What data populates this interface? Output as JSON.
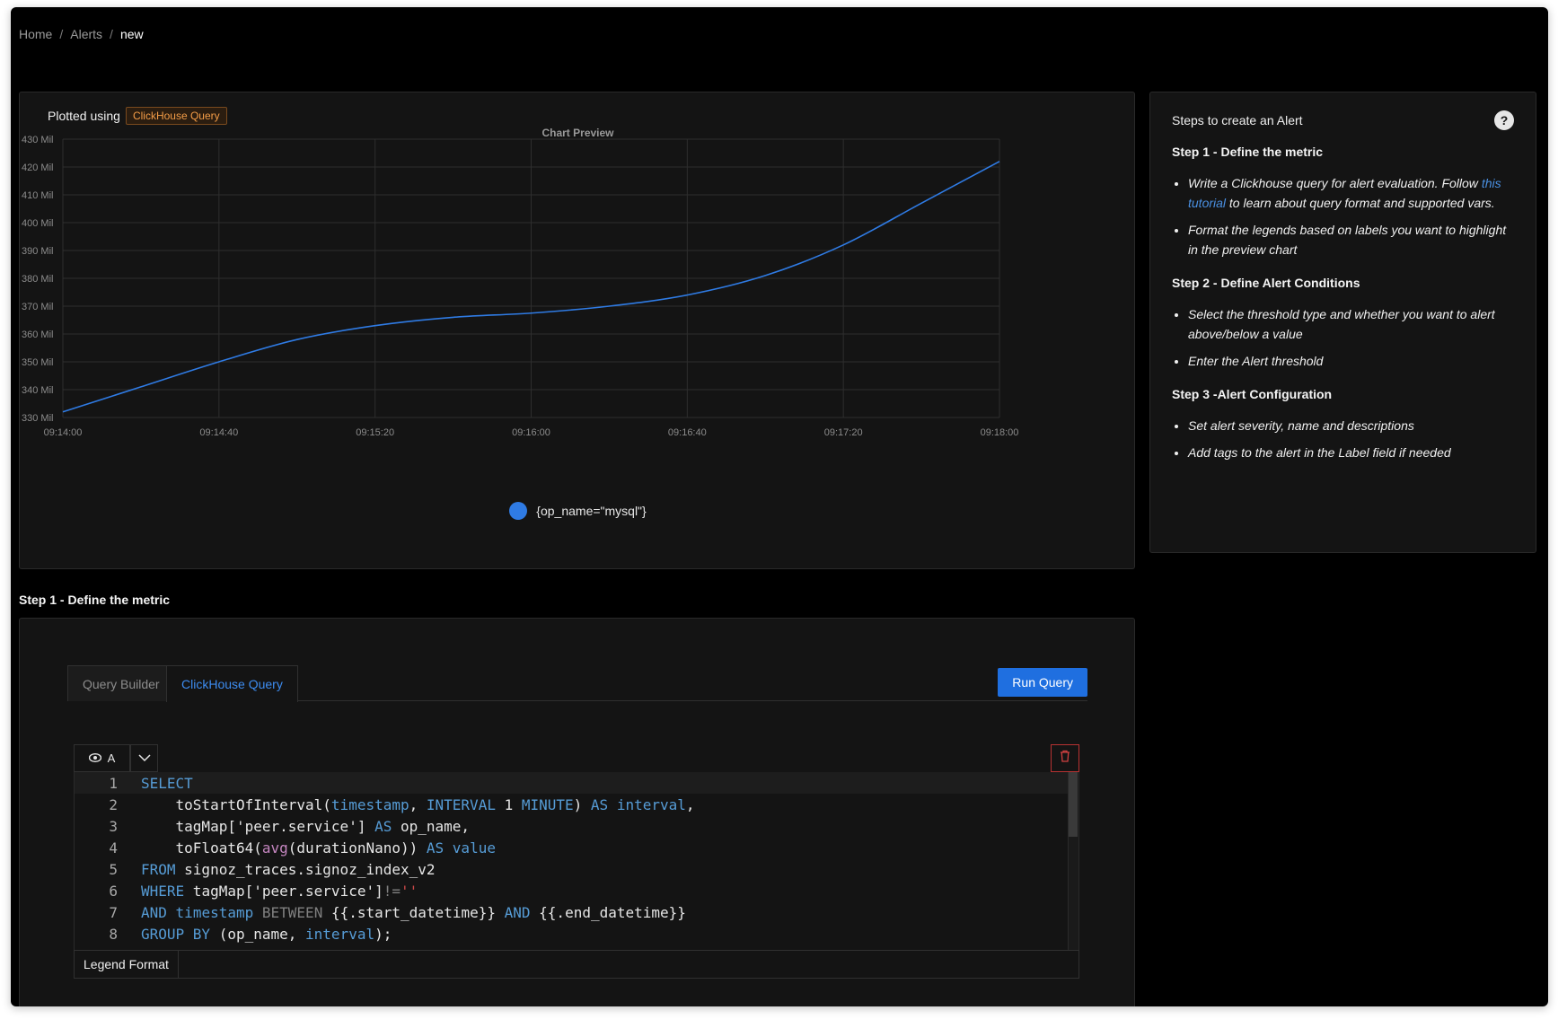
{
  "breadcrumb": {
    "items": [
      "Home",
      "Alerts",
      "new"
    ],
    "separator": "/"
  },
  "chart_panel": {
    "plotted_using_label": "Plotted using",
    "query_type_tag": "ClickHouse Query",
    "title": "Chart Preview"
  },
  "chart_data": {
    "type": "line",
    "title": "Chart Preview",
    "xlabel": "",
    "ylabel": "",
    "x_tick_labels": [
      "09:14:00",
      "09:14:40",
      "09:15:20",
      "09:16:00",
      "09:16:40",
      "09:17:20",
      "09:18:00"
    ],
    "y_tick_labels": [
      "330 Mil",
      "340 Mil",
      "350 Mil",
      "360 Mil",
      "370 Mil",
      "380 Mil",
      "390 Mil",
      "400 Mil",
      "410 Mil",
      "420 Mil",
      "430 Mil"
    ],
    "ylim": [
      330,
      430
    ],
    "y_unit": "Mil",
    "grid": true,
    "legend_position": "bottom-center",
    "series": [
      {
        "name": "{op_name=\"mysql\"}",
        "color": "#2f7be4",
        "x": [
          "09:14:00",
          "09:14:20",
          "09:14:40",
          "09:15:00",
          "09:15:20",
          "09:15:40",
          "09:16:00",
          "09:16:20",
          "09:16:40",
          "09:17:00",
          "09:17:20",
          "09:17:40",
          "09:18:00"
        ],
        "values": [
          332,
          341,
          350,
          358,
          363,
          366,
          367.5,
          370,
          374,
          381,
          392,
          407,
          422
        ]
      }
    ]
  },
  "steps_panel": {
    "heading": "Steps to create an Alert",
    "help_icon": "question-circle-icon",
    "step1": {
      "title": "Step 1 - Define the metric",
      "items": {
        "a_before": "Write a Clickhouse query for alert evaluation. Follow",
        "a_link": "this tutorial",
        "a_after": "to learn about query format and supported vars.",
        "b": "Format the legends based on labels you want to highlight in the preview chart"
      }
    },
    "step2": {
      "title": "Step 2 - Define Alert Conditions",
      "items": [
        "Select the threshold type and whether you want to alert above/below a value",
        "Enter the Alert threshold"
      ]
    },
    "step3": {
      "title": "Step 3 -Alert Configuration",
      "items": [
        "Set alert severity, name and descriptions",
        "Add tags to the alert in the Label field if needed"
      ]
    }
  },
  "section": {
    "title": "Step 1 - Define the metric"
  },
  "query_panel": {
    "tabs": [
      "Query Builder",
      "ClickHouse Query"
    ],
    "active_tab": "ClickHouse Query",
    "run_button": "Run Query",
    "query_name": "A",
    "legend_format_label": "Legend Format",
    "legend_format_value": "",
    "code_lines": [
      "1",
      "2",
      "3",
      "4",
      "5",
      "6",
      "7",
      "8"
    ]
  },
  "colors": {
    "accent": "#1f6fe0",
    "series_blue": "#2f7be4",
    "tag_orange": "#f39c47",
    "danger": "#b83232"
  }
}
